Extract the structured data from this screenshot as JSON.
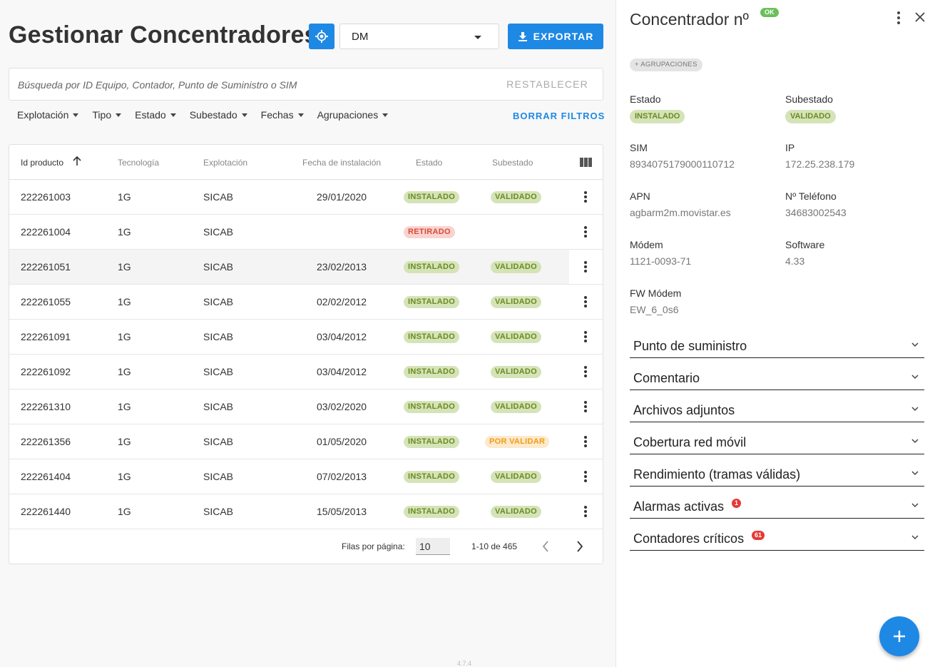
{
  "header": {
    "title": "Gestionar Concentradores",
    "select_value": "DM",
    "export_label": "EXPORTAR"
  },
  "search": {
    "placeholder": "Búsqueda por ID Equipo, Contador, Punto de Suministro o SIM",
    "reset_label": "RESTABLECER"
  },
  "filters": {
    "items": [
      "Explotación",
      "Tipo",
      "Estado",
      "Subestado",
      "Fechas",
      "Agrupaciones"
    ],
    "clear_label": "BORRAR FILTROS"
  },
  "table": {
    "columns": [
      "Id producto",
      "Tecnología",
      "Explotación",
      "Fecha de instalación",
      "Estado",
      "Subestado"
    ],
    "rows": [
      {
        "id": "222261003",
        "tech": "1G",
        "expl": "SICAB",
        "date": "29/01/2020",
        "estado": "INSTALADO",
        "subestado": "VALIDADO"
      },
      {
        "id": "222261004",
        "tech": "1G",
        "expl": "SICAB",
        "date": "",
        "estado": "RETIRADO",
        "subestado": ""
      },
      {
        "id": "222261051",
        "tech": "1G",
        "expl": "SICAB",
        "date": "23/02/2013",
        "estado": "INSTALADO",
        "subestado": "VALIDADO"
      },
      {
        "id": "222261055",
        "tech": "1G",
        "expl": "SICAB",
        "date": "02/02/2012",
        "estado": "INSTALADO",
        "subestado": "VALIDADO"
      },
      {
        "id": "222261091",
        "tech": "1G",
        "expl": "SICAB",
        "date": "03/04/2012",
        "estado": "INSTALADO",
        "subestado": "VALIDADO"
      },
      {
        "id": "222261092",
        "tech": "1G",
        "expl": "SICAB",
        "date": "03/04/2012",
        "estado": "INSTALADO",
        "subestado": "VALIDADO"
      },
      {
        "id": "222261310",
        "tech": "1G",
        "expl": "SICAB",
        "date": "03/02/2020",
        "estado": "INSTALADO",
        "subestado": "VALIDADO"
      },
      {
        "id": "222261356",
        "tech": "1G",
        "expl": "SICAB",
        "date": "01/05/2020",
        "estado": "INSTALADO",
        "subestado": "POR VALIDAR"
      },
      {
        "id": "222261404",
        "tech": "1G",
        "expl": "SICAB",
        "date": "07/02/2013",
        "estado": "INSTALADO",
        "subestado": "VALIDADO"
      },
      {
        "id": "222261440",
        "tech": "1G",
        "expl": "SICAB",
        "date": "15/05/2013",
        "estado": "INSTALADO",
        "subestado": "VALIDADO"
      }
    ],
    "pagination": {
      "rows_per_page_label": "Filas por página:",
      "rows_per_page": "10",
      "range": "1-10 de 465"
    }
  },
  "version": "4.7.4",
  "panel": {
    "title": "Concentrador nº",
    "status_badge": "OK",
    "agrupaciones_chip": "+ AGRUPACIONES",
    "fields": {
      "estado_label": "Estado",
      "estado_value": "INSTALADO",
      "subestado_label": "Subestado",
      "subestado_value": "VALIDADO",
      "sim_label": "SIM",
      "sim_value": "8934075179000110712",
      "ip_label": "IP",
      "ip_value": "172.25.238.179",
      "apn_label": "APN",
      "apn_value": "agbarm2m.movistar.es",
      "telefono_label": "Nº Teléfono",
      "telefono_value": "34683002543",
      "modem_label": "Módem",
      "modem_value": "1121-0093-71",
      "software_label": "Software",
      "software_value": "4.33",
      "fw_label": "FW Módem",
      "fw_value": "EW_6_0s6"
    },
    "sections": [
      {
        "label": "Punto de suministro",
        "count": ""
      },
      {
        "label": "Comentario",
        "count": ""
      },
      {
        "label": "Archivos adjuntos",
        "count": ""
      },
      {
        "label": "Cobertura red móvil",
        "count": ""
      },
      {
        "label": "Rendimiento (tramas válidas)",
        "count": ""
      },
      {
        "label": "Alarmas activas",
        "count": "1"
      },
      {
        "label": "Contadores críticos",
        "count": "61"
      }
    ]
  },
  "colors": {
    "primary": "#1e88e5",
    "installed_bg": "#d5e3b8",
    "retired_bg": "#f9d3cf",
    "pending_bg": "#fde9cc",
    "ok_green": "#6cbf5c",
    "alert_red": "#e53935"
  }
}
